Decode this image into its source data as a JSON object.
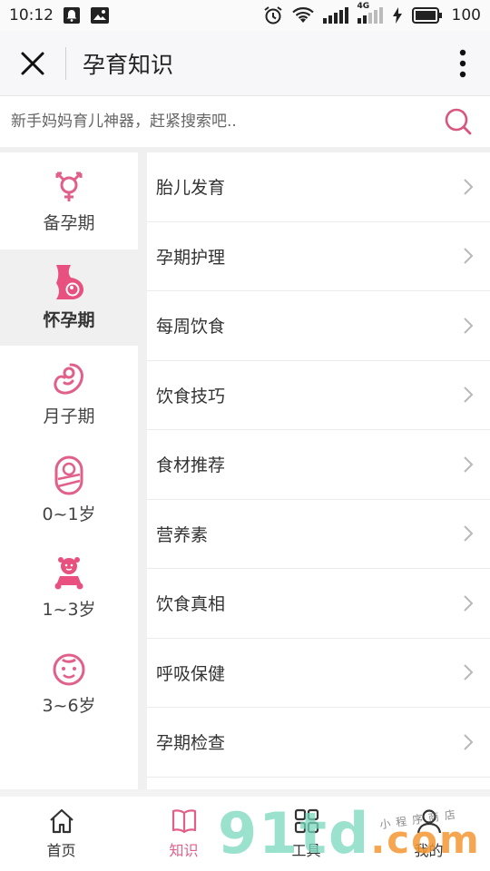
{
  "status_bar": {
    "time": "10:12",
    "network": "4G",
    "battery": "100"
  },
  "header": {
    "title": "孕育知识"
  },
  "search": {
    "placeholder": "新手妈妈育儿神器，赶紧搜索吧.."
  },
  "sidebar": {
    "items": [
      {
        "label": "备孕期",
        "icon": "gender-icon"
      },
      {
        "label": "怀孕期",
        "icon": "pregnant-icon"
      },
      {
        "label": "月子期",
        "icon": "fetus-icon"
      },
      {
        "label": "0~1岁",
        "icon": "swaddled-baby-icon"
      },
      {
        "label": "1~3岁",
        "icon": "toddler-icon"
      },
      {
        "label": "3~6岁",
        "icon": "child-face-icon"
      }
    ]
  },
  "list": {
    "items": [
      "胎儿发育",
      "孕期护理",
      "每周饮食",
      "饮食技巧",
      "食材推荐",
      "营养素",
      "饮食真相",
      "呼吸保健",
      "孕期检查"
    ]
  },
  "tabbar": {
    "tabs": [
      {
        "label": "首页",
        "icon": "home-icon"
      },
      {
        "label": "知识",
        "icon": "book-icon"
      },
      {
        "label": "工具",
        "icon": "grid-icon"
      },
      {
        "label": "我的",
        "icon": "user-icon"
      }
    ]
  },
  "watermark": {
    "brand": "91td",
    "suffix": ".com",
    "tagline": "小程序商店"
  },
  "colors": {
    "accent": "#e0608a",
    "sidebar_active_bg": "#f0f0f0"
  }
}
